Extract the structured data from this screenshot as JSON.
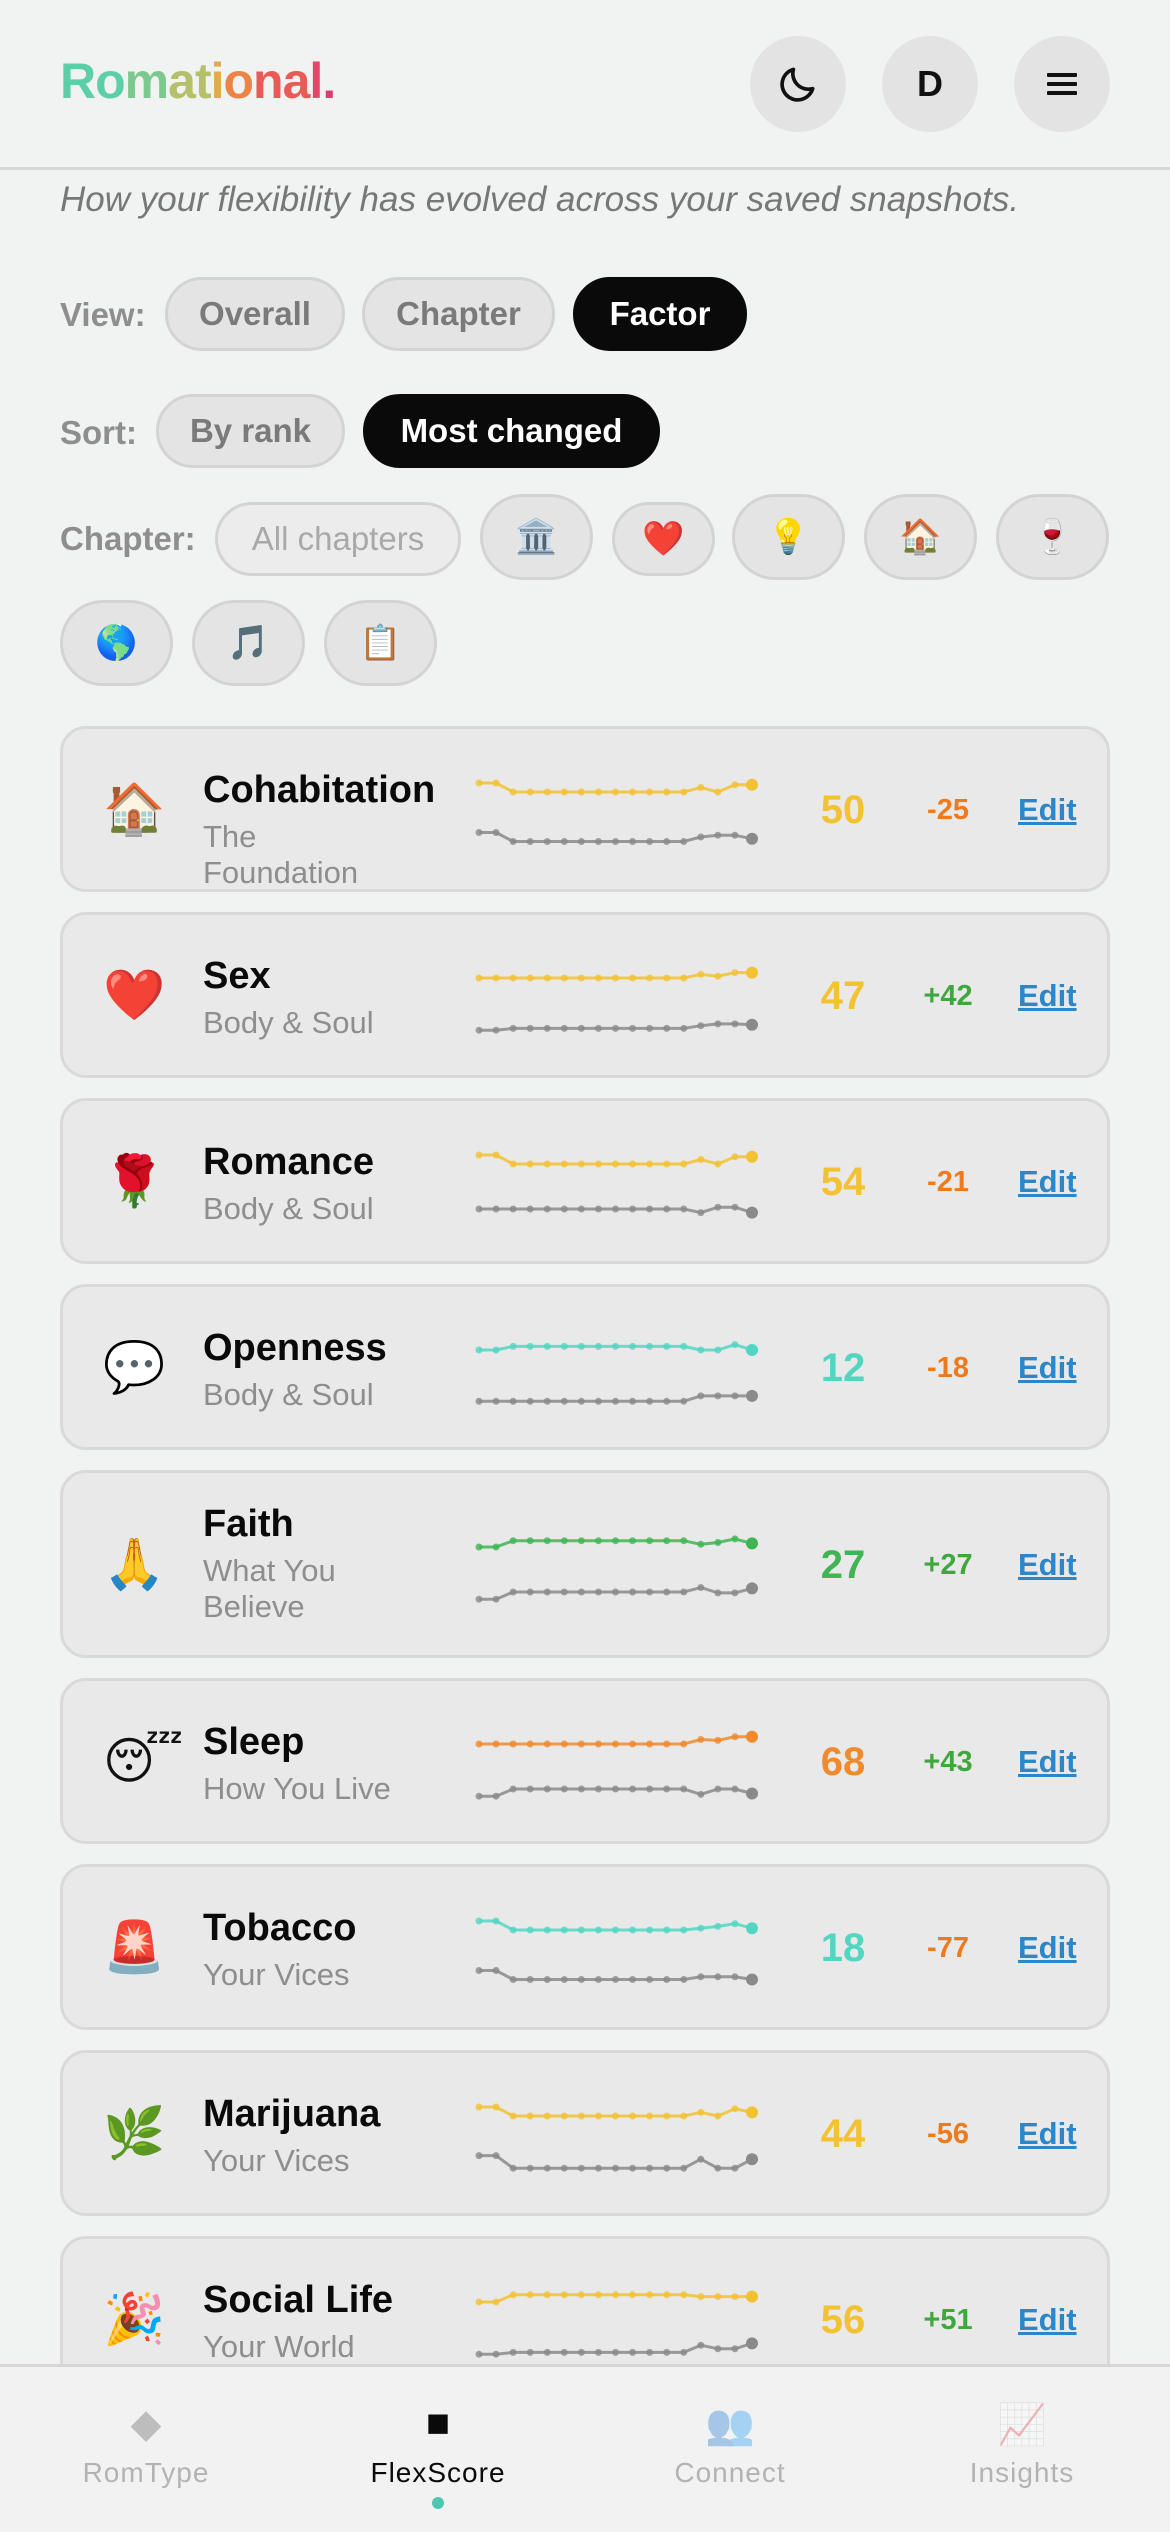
{
  "header": {
    "logo_text": "Romational.",
    "logo_colors": [
      "#5ccfa9",
      "#7cc98f",
      "#b6c06b",
      "#e2a94d",
      "#ec8447",
      "#ea5a56",
      "#e24668",
      "#d83d74"
    ],
    "theme_icon": "moon-icon",
    "avatar_letter": "D",
    "menu_glyph": "≡"
  },
  "subtitle": "How your flexibility has evolved across your saved snapshots.",
  "view": {
    "label": "View:",
    "options": [
      "Overall",
      "Chapter",
      "Factor"
    ],
    "selected": "Factor"
  },
  "sort": {
    "label": "Sort:",
    "options": [
      "By rank",
      "Most changed"
    ],
    "selected": "Most changed"
  },
  "chapter_filter": {
    "label": "Chapter:",
    "all_label": "All chapters",
    "emoji_options": [
      "🏛️",
      "❤️",
      "💡",
      "🏠",
      "🍷",
      "🌎",
      "🎵",
      "📋"
    ]
  },
  "factors": [
    {
      "icon": "🏠",
      "name": "Cohabitation",
      "chapter": "The Foundation",
      "score": "50",
      "delta": "-25",
      "edit": "Edit",
      "color": "#f2c233",
      "current": [
        2,
        2,
        1,
        1,
        1,
        1,
        1,
        1,
        1,
        1,
        1,
        1,
        1,
        1.5,
        1,
        1.8,
        1.8
      ],
      "previous": [
        1.5,
        1.5,
        0.5,
        0.5,
        0.5,
        0.5,
        0.5,
        0.5,
        0.5,
        0.5,
        0.5,
        0.5,
        0.5,
        1,
        1.2,
        1.2,
        0.8
      ]
    },
    {
      "icon": "❤️",
      "name": "Sex",
      "chapter": "Body & Soul",
      "score": "47",
      "delta": "+42",
      "edit": "Edit",
      "color": "#f2c233",
      "current": [
        1,
        1,
        1,
        1,
        1,
        1,
        1,
        1,
        1,
        1,
        1,
        1,
        1,
        1.4,
        1.2,
        1.6,
        1.6
      ],
      "previous": [
        0.2,
        0.2,
        0.4,
        0.4,
        0.4,
        0.4,
        0.4,
        0.4,
        0.4,
        0.4,
        0.4,
        0.4,
        0.4,
        0.7,
        0.9,
        0.9,
        0.8
      ]
    },
    {
      "icon": "🌹",
      "name": "Romance",
      "chapter": "Body & Soul",
      "score": "54",
      "delta": "-21",
      "edit": "Edit",
      "color": "#f2c233",
      "current": [
        2,
        2,
        1,
        1,
        1,
        1,
        1,
        1,
        1,
        1,
        1,
        1,
        1,
        1.5,
        1,
        1.8,
        1.8
      ],
      "previous": [
        1,
        1,
        1,
        1,
        1,
        1,
        1,
        1,
        1,
        1,
        1,
        1,
        1,
        0.6,
        1.2,
        1.2,
        0.6
      ]
    },
    {
      "icon": "💬",
      "name": "Openness",
      "chapter": "Body & Soul",
      "score": "12",
      "delta": "-18",
      "edit": "Edit",
      "color": "#52d6c2",
      "current": [
        1,
        1,
        1.4,
        1.4,
        1.4,
        1.4,
        1.4,
        1.4,
        1.4,
        1.4,
        1.4,
        1.4,
        1.4,
        1,
        1,
        1.6,
        1
      ],
      "previous": [
        0.3,
        0.3,
        0.3,
        0.3,
        0.3,
        0.3,
        0.3,
        0.3,
        0.3,
        0.3,
        0.3,
        0.3,
        0.3,
        0.9,
        0.9,
        0.9,
        0.9
      ]
    },
    {
      "icon": "🙏",
      "name": "Faith",
      "chapter": "What You Believe",
      "score": "27",
      "delta": "+27",
      "edit": "Edit",
      "color": "#3fb553",
      "current": [
        1,
        1,
        1.7,
        1.7,
        1.7,
        1.7,
        1.7,
        1.7,
        1.7,
        1.7,
        1.7,
        1.7,
        1.7,
        1.3,
        1.5,
        1.9,
        1.4
      ],
      "previous": [
        0.2,
        0.2,
        1,
        1,
        1,
        1,
        1,
        1,
        1,
        1,
        1,
        1,
        1,
        1.5,
        0.9,
        0.9,
        1.4
      ]
    },
    {
      "icon": "😴",
      "name": "Sleep",
      "chapter": "How You Live",
      "score": "68",
      "delta": "+43",
      "edit": "Edit",
      "color": "#ef8a2d",
      "current": [
        1,
        1,
        1,
        1,
        1,
        1,
        1,
        1,
        1,
        1,
        1,
        1,
        1,
        1.5,
        1.4,
        1.8,
        1.8
      ],
      "previous": [
        0.2,
        0.2,
        1,
        1,
        1,
        1,
        1,
        1,
        1,
        1,
        1,
        1,
        1,
        0.4,
        1,
        1,
        0.5
      ]
    },
    {
      "icon": "🚨",
      "name": "Tobacco",
      "chapter": "Your Vices",
      "score": "18",
      "delta": "-77",
      "edit": "Edit",
      "color": "#52d6c2",
      "current": [
        2,
        2,
        1,
        1,
        1,
        1,
        1,
        1,
        1,
        1,
        1,
        1,
        1,
        1.2,
        1.4,
        1.7,
        1.2
      ],
      "previous": [
        1.5,
        1.5,
        0.5,
        0.5,
        0.5,
        0.5,
        0.5,
        0.5,
        0.5,
        0.5,
        0.5,
        0.5,
        0.5,
        0.8,
        0.8,
        0.8,
        0.5
      ]
    },
    {
      "icon": "🌿",
      "name": "Marijuana",
      "chapter": "Your Vices",
      "score": "44",
      "delta": "-56",
      "edit": "Edit",
      "color": "#f2c233",
      "current": [
        2,
        2,
        1,
        1,
        1,
        1,
        1,
        1,
        1,
        1,
        1,
        1,
        1,
        1.4,
        1,
        1.8,
        1.4
      ],
      "previous": [
        1.6,
        1.6,
        0.2,
        0.2,
        0.2,
        0.2,
        0.2,
        0.2,
        0.2,
        0.2,
        0.2,
        0.2,
        0.2,
        1.2,
        0.2,
        0.2,
        1.2
      ]
    },
    {
      "icon": "🎉",
      "name": "Social Life",
      "chapter": "Your World",
      "score": "56",
      "delta": "+51",
      "edit": "Edit",
      "color": "#f2c233",
      "current": [
        1,
        1,
        1.8,
        1.8,
        1.8,
        1.8,
        1.8,
        1.8,
        1.8,
        1.8,
        1.8,
        1.8,
        1.8,
        1.6,
        1.6,
        1.6,
        1.6
      ],
      "previous": [
        0.2,
        0.2,
        0.4,
        0.4,
        0.4,
        0.4,
        0.4,
        0.4,
        0.4,
        0.4,
        0.4,
        0.4,
        0.4,
        1.2,
        0.8,
        0.8,
        1.4
      ]
    }
  ],
  "delta_colors": {
    "positive": "#3ea83c",
    "negative": "#ee7a1c"
  },
  "previous_color": "#8a8a8a",
  "bottom_nav": [
    {
      "label": "RomType",
      "icon": "◆",
      "icon_name": "diamond-icon",
      "active": false
    },
    {
      "label": "FlexScore",
      "icon": "■",
      "icon_name": "square-icon",
      "active": true
    },
    {
      "label": "Connect",
      "icon": "👥",
      "icon_name": "people-icon",
      "active": false
    },
    {
      "label": "Insights",
      "icon": "📈",
      "icon_name": "chart-icon",
      "active": false
    }
  ]
}
